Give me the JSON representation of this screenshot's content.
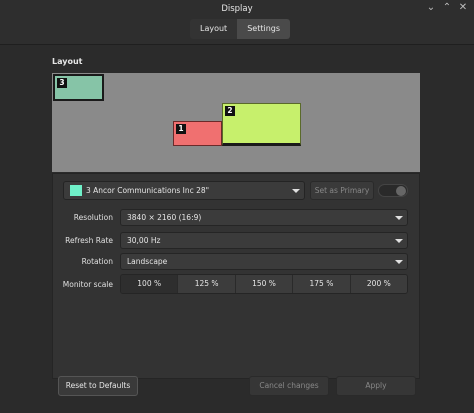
{
  "window": {
    "title": "Display"
  },
  "tabs": [
    {
      "label": "Layout",
      "active": false
    },
    {
      "label": "Settings",
      "active": true
    }
  ],
  "layout": {
    "section_label": "Layout",
    "monitors": [
      {
        "number": "3",
        "color": "#86c4a7",
        "selected": true
      },
      {
        "number": "1",
        "color": "#f07070",
        "selected": false
      },
      {
        "number": "2",
        "color": "#c7f06c",
        "selected": false
      }
    ]
  },
  "monitor_select": {
    "swatch_color": "#6ff0c8",
    "text": "3   Ancor Communications Inc 28\""
  },
  "set_primary": {
    "label": "Set as Primary",
    "enabled": false
  },
  "enable_toggle": {
    "on": false
  },
  "settings": {
    "resolution": {
      "label": "Resolution",
      "value": "3840 × 2160 (16:9)"
    },
    "refresh_rate": {
      "label": "Refresh Rate",
      "value": "30,00 Hz"
    },
    "rotation": {
      "label": "Rotation",
      "value": "Landscape"
    },
    "monitor_scale": {
      "label": "Monitor scale",
      "options": [
        "100 %",
        "125 %",
        "150 %",
        "175 %",
        "200 %"
      ],
      "selected": "100 %"
    }
  },
  "buttons": {
    "reset": "Reset to Defaults",
    "cancel": "Cancel changes",
    "apply": "Apply"
  }
}
